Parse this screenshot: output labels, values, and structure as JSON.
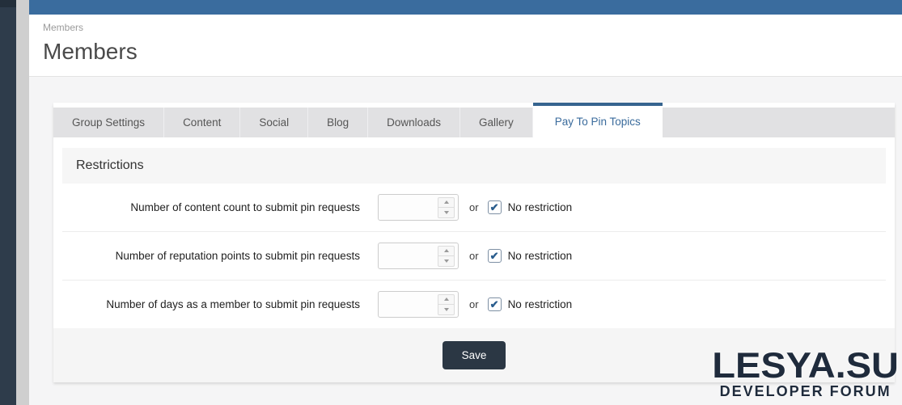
{
  "header": {
    "breadcrumb": "Members",
    "title": "Members"
  },
  "tabs": {
    "items": [
      {
        "label": "Group Settings",
        "active": false
      },
      {
        "label": "Content",
        "active": false
      },
      {
        "label": "Social",
        "active": false
      },
      {
        "label": "Blog",
        "active": false
      },
      {
        "label": "Downloads",
        "active": false
      },
      {
        "label": "Gallery",
        "active": false
      },
      {
        "label": "Pay To Pin Topics",
        "active": true
      }
    ]
  },
  "panel": {
    "section_title": "Restrictions",
    "rows": [
      {
        "label": "Number of content count to submit pin requests",
        "input_value": "",
        "or_label": "or",
        "checkbox_checked": true,
        "checkbox_label": "No restriction"
      },
      {
        "label": "Number of reputation points to submit pin requests",
        "input_value": "",
        "or_label": "or",
        "checkbox_checked": true,
        "checkbox_label": "No restriction"
      },
      {
        "label": "Number of days as a member to submit pin requests",
        "input_value": "",
        "or_label": "or",
        "checkbox_checked": true,
        "checkbox_label": "No restriction"
      }
    ],
    "save_label": "Save",
    "check_glyph": "✔"
  },
  "watermark": {
    "line1": "LESYA.SU",
    "line2": "DEVELOPER FORUM"
  },
  "colors": {
    "accent_blue": "#3a6c9e",
    "sidebar_dark": "#2e3c4b",
    "save_button": "#2b3744",
    "checkbox_check": "#2b5e8e",
    "watermark": "#1f2b3c"
  }
}
